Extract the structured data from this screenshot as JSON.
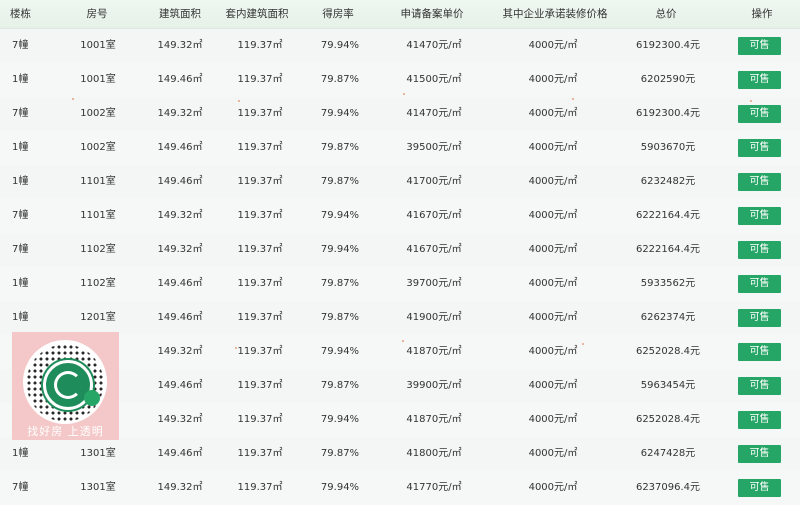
{
  "headers": [
    "楼栋",
    "房号",
    "建筑面积",
    "套内建筑面积",
    "得房率",
    "申请备案单价",
    "其中企业承诺装修价格",
    "总价",
    "操作"
  ],
  "rows": [
    {
      "building": "7幢",
      "room": "1001室",
      "area": "149.32㎡",
      "inner_area": "119.37㎡",
      "ratio": "79.94%",
      "unit_price": "41470元/㎡",
      "decoration": "4000元/㎡",
      "total": "6192300.4元",
      "action": "可售"
    },
    {
      "building": "1幢",
      "room": "1001室",
      "area": "149.46㎡",
      "inner_area": "119.37㎡",
      "ratio": "79.87%",
      "unit_price": "41500元/㎡",
      "decoration": "4000元/㎡",
      "total": "6202590元",
      "action": "可售"
    },
    {
      "building": "7幢",
      "room": "1002室",
      "area": "149.32㎡",
      "inner_area": "119.37㎡",
      "ratio": "79.94%",
      "unit_price": "41470元/㎡",
      "decoration": "4000元/㎡",
      "total": "6192300.4元",
      "action": "可售"
    },
    {
      "building": "1幢",
      "room": "1002室",
      "area": "149.46㎡",
      "inner_area": "119.37㎡",
      "ratio": "79.87%",
      "unit_price": "39500元/㎡",
      "decoration": "4000元/㎡",
      "total": "5903670元",
      "action": "可售"
    },
    {
      "building": "1幢",
      "room": "1101室",
      "area": "149.46㎡",
      "inner_area": "119.37㎡",
      "ratio": "79.87%",
      "unit_price": "41700元/㎡",
      "decoration": "4000元/㎡",
      "total": "6232482元",
      "action": "可售"
    },
    {
      "building": "7幢",
      "room": "1101室",
      "area": "149.32㎡",
      "inner_area": "119.37㎡",
      "ratio": "79.94%",
      "unit_price": "41670元/㎡",
      "decoration": "4000元/㎡",
      "total": "6222164.4元",
      "action": "可售"
    },
    {
      "building": "7幢",
      "room": "1102室",
      "area": "149.32㎡",
      "inner_area": "119.37㎡",
      "ratio": "79.94%",
      "unit_price": "41670元/㎡",
      "decoration": "4000元/㎡",
      "total": "6222164.4元",
      "action": "可售"
    },
    {
      "building": "1幢",
      "room": "1102室",
      "area": "149.46㎡",
      "inner_area": "119.37㎡",
      "ratio": "79.87%",
      "unit_price": "39700元/㎡",
      "decoration": "4000元/㎡",
      "total": "5933562元",
      "action": "可售"
    },
    {
      "building": "1幢",
      "room": "1201室",
      "area": "149.46㎡",
      "inner_area": "119.37㎡",
      "ratio": "79.87%",
      "unit_price": "41900元/㎡",
      "decoration": "4000元/㎡",
      "total": "6262374元",
      "action": "可售"
    },
    {
      "building": "",
      "room": "",
      "area": "149.32㎡",
      "inner_area": "119.37㎡",
      "ratio": "79.94%",
      "unit_price": "41870元/㎡",
      "decoration": "4000元/㎡",
      "total": "6252028.4元",
      "action": "可售"
    },
    {
      "building": "",
      "room": "",
      "area": "149.46㎡",
      "inner_area": "119.37㎡",
      "ratio": "79.87%",
      "unit_price": "39900元/㎡",
      "decoration": "4000元/㎡",
      "total": "5963454元",
      "action": "可售"
    },
    {
      "building": "",
      "room": "",
      "area": "149.32㎡",
      "inner_area": "119.37㎡",
      "ratio": "79.94%",
      "unit_price": "41870元/㎡",
      "decoration": "4000元/㎡",
      "total": "6252028.4元",
      "action": "可售"
    },
    {
      "building": "1幢",
      "room": "1301室",
      "area": "149.46㎡",
      "inner_area": "119.37㎡",
      "ratio": "79.87%",
      "unit_price": "41800元/㎡",
      "decoration": "4000元/㎡",
      "total": "6247428元",
      "action": "可售"
    },
    {
      "building": "7幢",
      "room": "1301室",
      "area": "149.32㎡",
      "inner_area": "119.37㎡",
      "ratio": "79.94%",
      "unit_price": "41770元/㎡",
      "decoration": "4000元/㎡",
      "total": "6237096.4元",
      "action": "可售"
    }
  ],
  "qr_badge": {
    "caption": "找好房 上透明"
  },
  "colors": {
    "accent": "#25a666",
    "header_bg": "#e9f4eb",
    "qr_bg": "#f4c8c8"
  }
}
